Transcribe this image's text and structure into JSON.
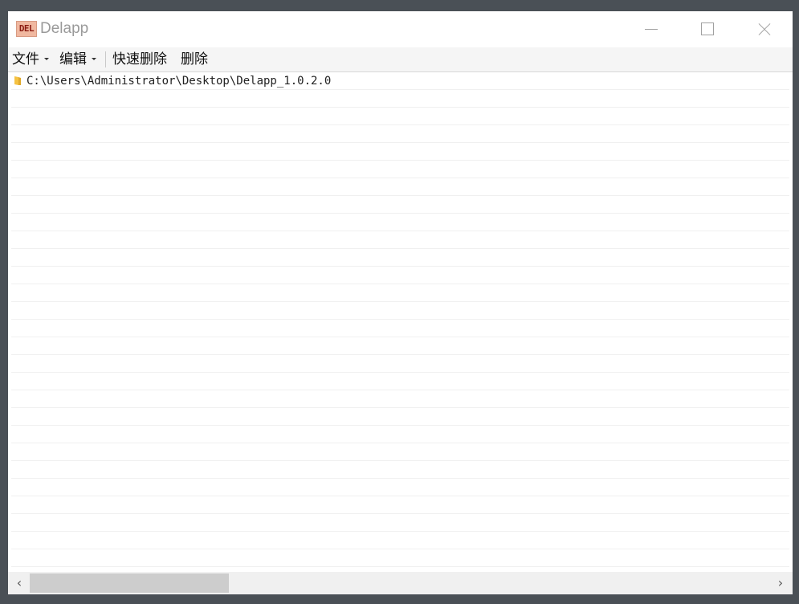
{
  "window": {
    "app_icon_text": "DEL",
    "title": "Delapp"
  },
  "menubar": {
    "file_label": "文件",
    "edit_label": "编辑",
    "quick_delete_label": "快速删除",
    "delete_label": "删除"
  },
  "list": {
    "items": [
      {
        "icon": "folder-icon",
        "path": "C:\\Users\\Administrator\\Desktop\\Delapp_1.0.2.0"
      }
    ]
  },
  "scrollbar": {
    "left_arrow": "‹",
    "right_arrow": "›"
  },
  "colors": {
    "background": "#4a5056",
    "folder": "#f5c242",
    "icon_bg": "#f0b8a0"
  }
}
